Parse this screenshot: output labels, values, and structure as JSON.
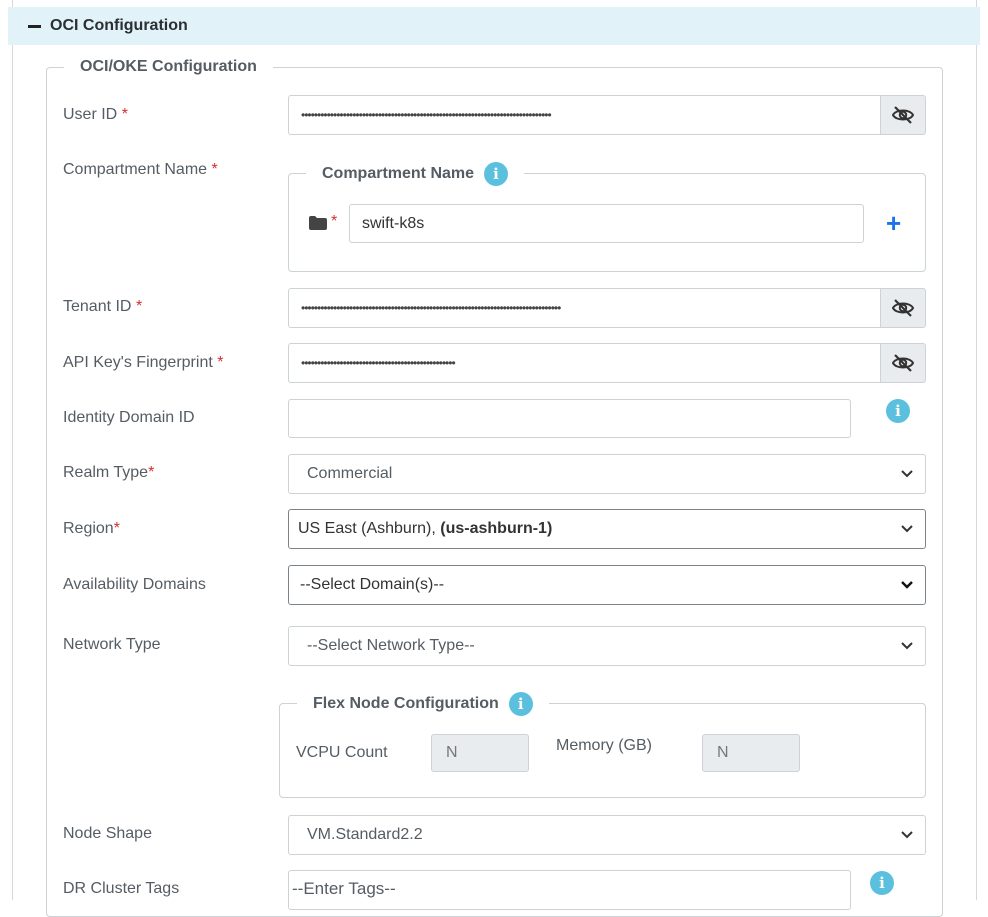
{
  "section": {
    "title": "OCI Configuration"
  },
  "oke_group": {
    "legend": "OCI/OKE Configuration"
  },
  "fields": {
    "user_id": {
      "label": "User ID",
      "required": "*",
      "value": "••••••••••••••••••••••••••••••••••••••••••••••••••••••••••••••••••••••••••••••"
    },
    "compartment_name": {
      "label": "Compartment Name",
      "required": "*"
    },
    "tenant_id": {
      "label": "Tenant ID",
      "required": "*",
      "value": "•••••••••••••••••••••••••••••••••••••••••••••••••••••••••••••••••••••••••••••••••"
    },
    "api_fingerprint": {
      "label": "API Key's Fingerprint",
      "required": "*",
      "value": "••••••••••••••••••••••••••••••••••••••••••••••••"
    },
    "identity_domain": {
      "label": "Identity Domain ID",
      "value": ""
    },
    "realm_type": {
      "label": "Realm Type",
      "required": "*",
      "value": "Commercial"
    },
    "region": {
      "label": "Region",
      "required": "*",
      "value_plain": "US East (Ashburn), ",
      "value_bold": "(us-ashburn-1)"
    },
    "availability_domains": {
      "label": "Availability Domains",
      "value": "--Select Domain(s)--"
    },
    "network_type": {
      "label": "Network Type",
      "value": "--Select Network Type--"
    },
    "node_shape": {
      "label": "Node Shape",
      "value": "VM.Standard2.2"
    },
    "dr_cluster_tags": {
      "label": "DR Cluster Tags",
      "placeholder": "--Enter Tags--"
    }
  },
  "compartment_group": {
    "legend": "Compartment Name",
    "required": "*",
    "value": "swift-k8s"
  },
  "flex_group": {
    "legend": "Flex Node Configuration",
    "vcpu_label": "VCPU Count",
    "vcpu_placeholder": "N",
    "memory_label": "Memory (GB)",
    "memory_placeholder": "N"
  },
  "icons": {
    "collapse": "minus-icon",
    "reveal": "eye-slash-icon",
    "info": "info-icon",
    "folder": "folder-icon",
    "add": "plus-icon",
    "dropdown": "chevron-down-icon"
  },
  "colors": {
    "header_bg": "#e1f2f8",
    "required": "#d72d2d",
    "info": "#5bc0de",
    "add": "#1a73e8"
  }
}
